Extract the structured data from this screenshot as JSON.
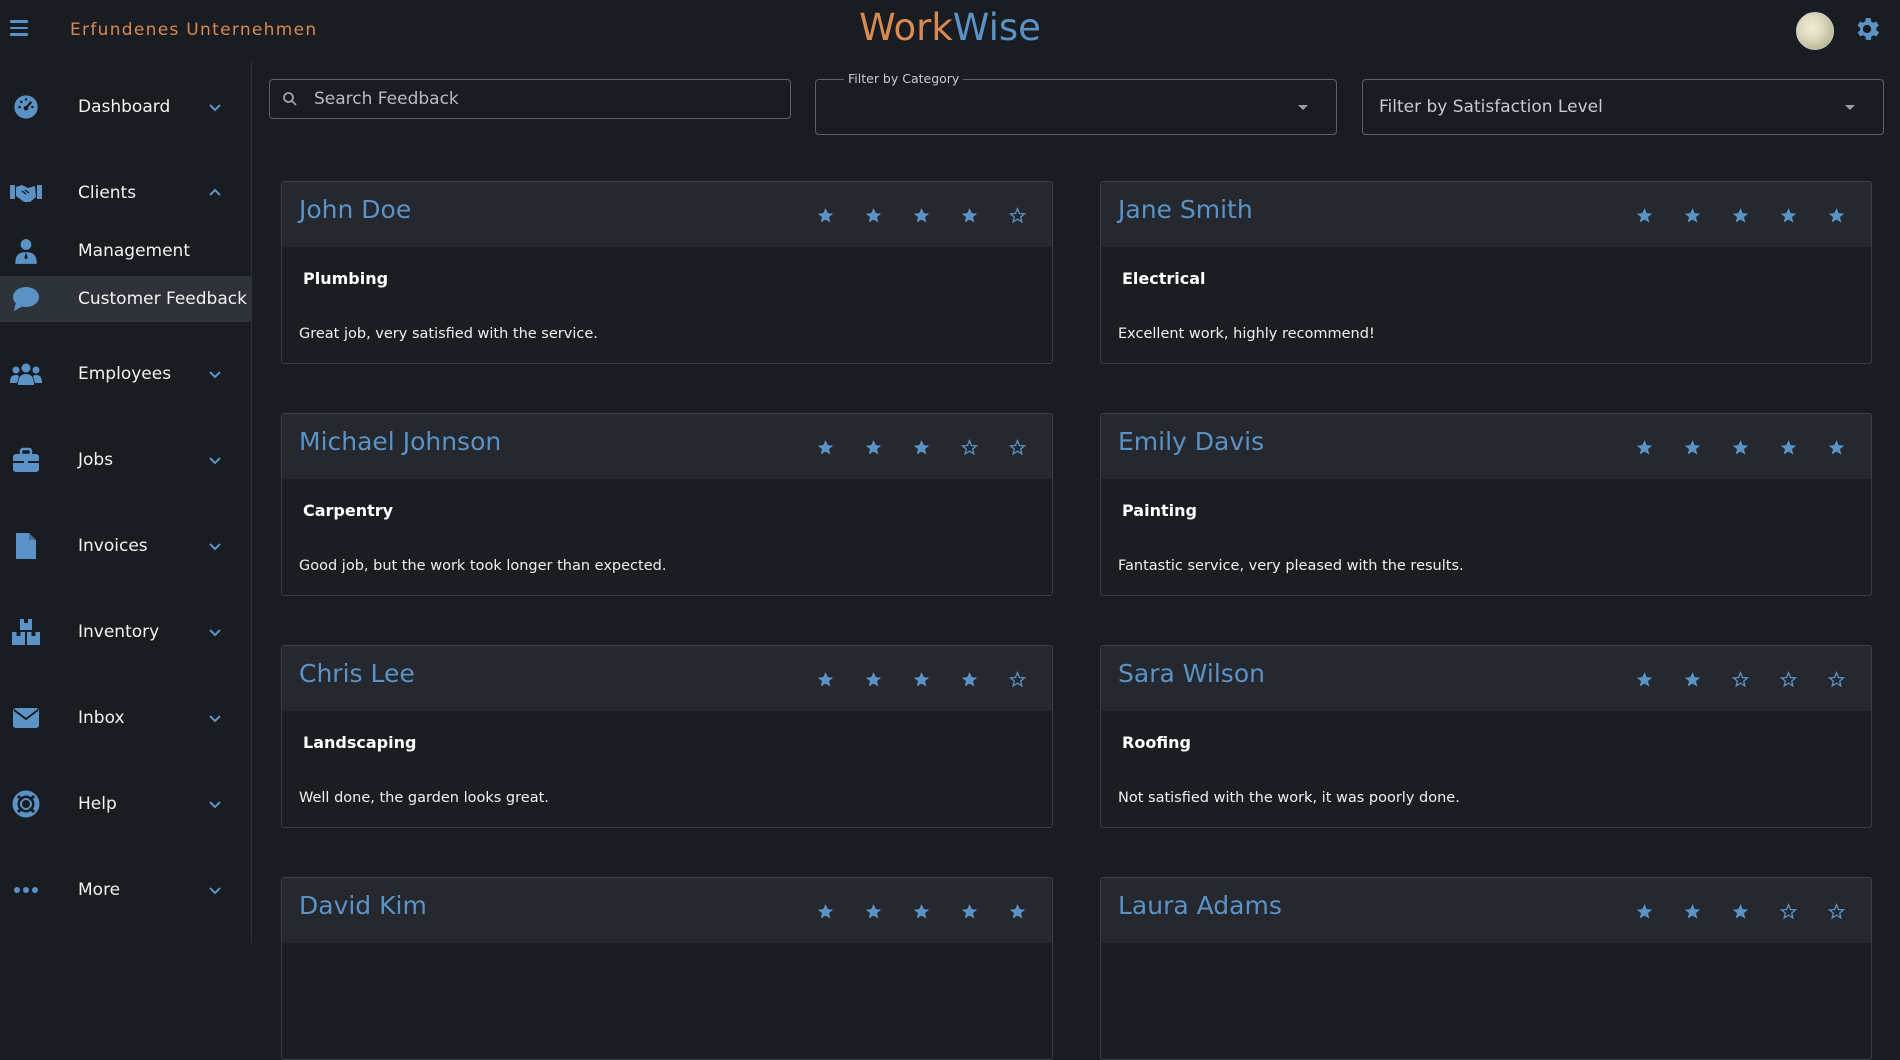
{
  "header": {
    "company": "Erfundenes Unternehmen",
    "brand_part1": "Work",
    "brand_part2": "Wise"
  },
  "colors": {
    "accent_blue": "#5b93c6",
    "accent_orange": "#d98a52",
    "background": "#191c21",
    "card_header": "#25282e"
  },
  "sidebar": {
    "items": [
      {
        "label": "Dashboard",
        "icon": "speedometer-icon",
        "expanded": false
      },
      {
        "label": "Clients",
        "icon": "handshake-icon",
        "expanded": true
      },
      {
        "label": "Management",
        "icon": "person-icon"
      },
      {
        "label": "Customer Feedback",
        "icon": "chat-bubble-icon",
        "active": true
      },
      {
        "label": "Employees",
        "icon": "people-icon",
        "expanded": false
      },
      {
        "label": "Jobs",
        "icon": "briefcase-icon",
        "expanded": false
      },
      {
        "label": "Invoices",
        "icon": "document-icon",
        "expanded": false
      },
      {
        "label": "Inventory",
        "icon": "boxes-icon",
        "expanded": false
      },
      {
        "label": "Inbox",
        "icon": "envelope-icon",
        "expanded": false
      },
      {
        "label": "Help",
        "icon": "lifebuoy-icon",
        "expanded": false
      },
      {
        "label": "More",
        "icon": "more-dots-icon",
        "expanded": false
      }
    ]
  },
  "filters": {
    "search_placeholder": "Search Feedback",
    "search_value": "",
    "category_label": "Filter by Category",
    "category_value": "",
    "satisfaction_placeholder": "Filter by Satisfaction Level"
  },
  "feedback": [
    {
      "name": "John Doe",
      "rating": 4,
      "category": "Plumbing",
      "comment": "Great job, very satisfied with the service."
    },
    {
      "name": "Jane Smith",
      "rating": 5,
      "category": "Electrical",
      "comment": "Excellent work, highly recommend!"
    },
    {
      "name": "Michael Johnson",
      "rating": 3,
      "category": "Carpentry",
      "comment": "Good job, but the work took longer than expected."
    },
    {
      "name": "Emily Davis",
      "rating": 5,
      "category": "Painting",
      "comment": "Fantastic service, very pleased with the results."
    },
    {
      "name": "Chris Lee",
      "rating": 4,
      "category": "Landscaping",
      "comment": "Well done, the garden looks great."
    },
    {
      "name": "Sara Wilson",
      "rating": 2,
      "category": "Roofing",
      "comment": "Not satisfied with the work, it was poorly done."
    },
    {
      "name": "David Kim",
      "rating": 5,
      "category": "",
      "comment": ""
    },
    {
      "name": "Laura Adams",
      "rating": 3,
      "category": "",
      "comment": ""
    }
  ]
}
